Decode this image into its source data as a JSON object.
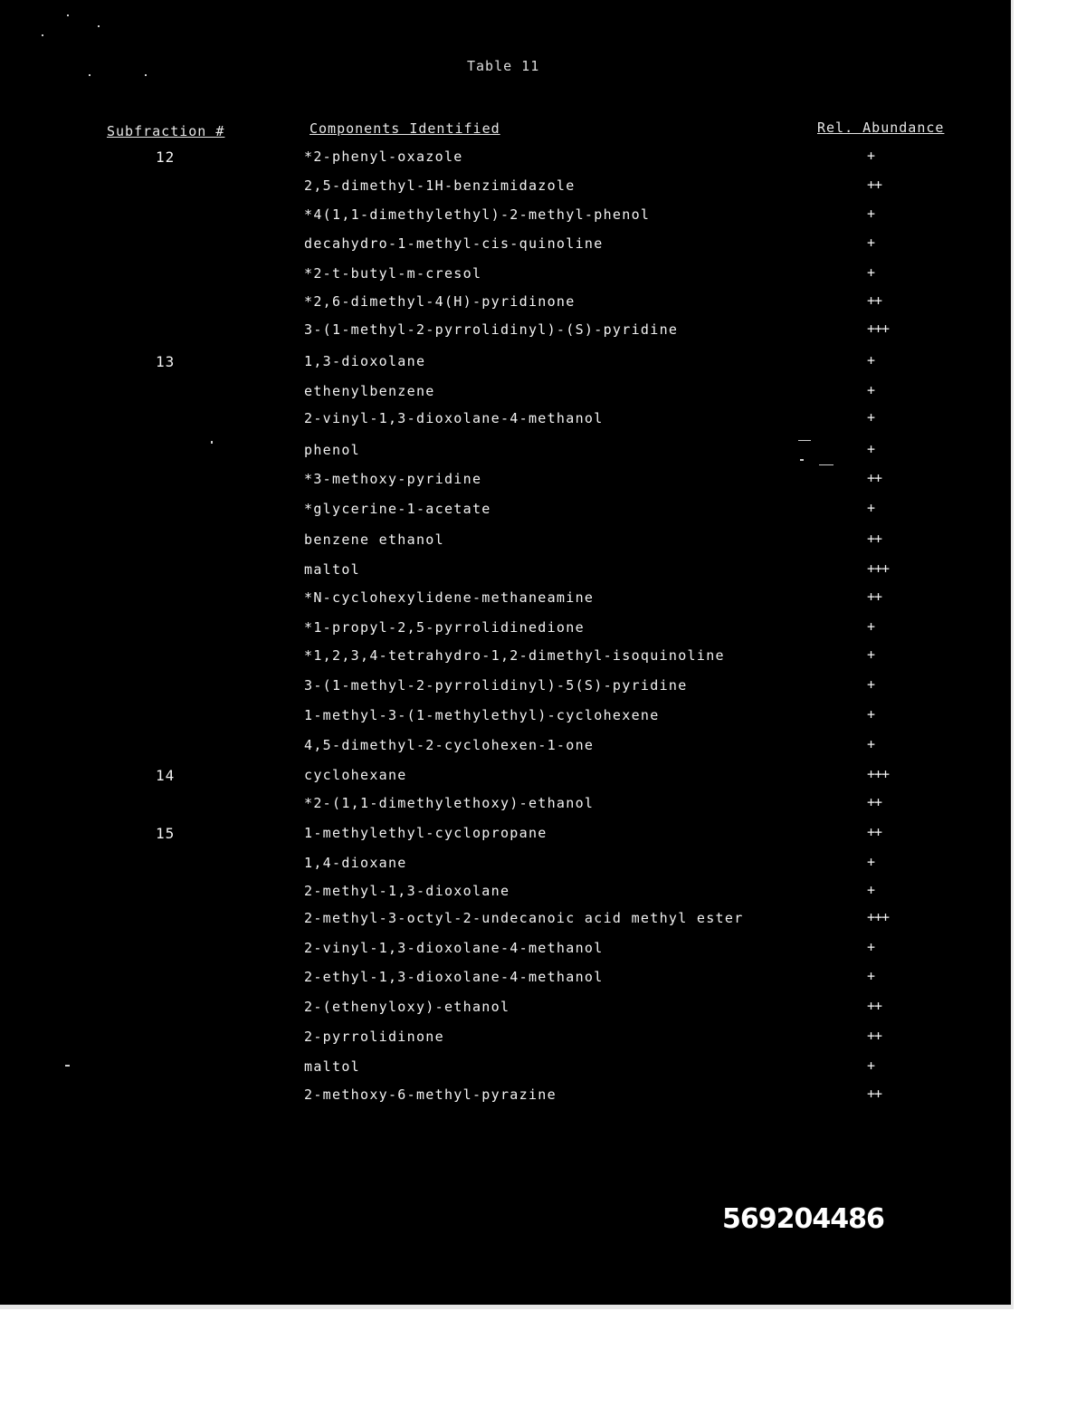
{
  "table": {
    "title": "Table 11",
    "headers": {
      "subfraction": "Subfraction #",
      "components": "Components Identified",
      "abundance": "Rel. Abundance"
    },
    "rows": [
      {
        "subfraction": "12",
        "component": "*2-phenyl-oxazole",
        "abundance": "+"
      },
      {
        "subfraction": "",
        "component": "2,5-dimethyl-1H-benzimidazole",
        "abundance": "++"
      },
      {
        "subfraction": "",
        "component": "*4(1,1-dimethylethyl)-2-methyl-phenol",
        "abundance": "+"
      },
      {
        "subfraction": "",
        "component": "decahydro-1-methyl-cis-quinoline",
        "abundance": "+"
      },
      {
        "subfraction": "",
        "component": "*2-t-butyl-m-cresol",
        "abundance": "+"
      },
      {
        "subfraction": "",
        "component": "*2,6-dimethyl-4(H)-pyridinone",
        "abundance": "++"
      },
      {
        "subfraction": "",
        "component": "3-(1-methyl-2-pyrrolidinyl)-(S)-pyridine",
        "abundance": "+++"
      },
      {
        "subfraction": "13",
        "component": "1,3-dioxolane",
        "abundance": "+"
      },
      {
        "subfraction": "",
        "component": "ethenylbenzene",
        "abundance": "+"
      },
      {
        "subfraction": "",
        "component": "2-vinyl-1,3-dioxolane-4-methanol",
        "abundance": "+"
      },
      {
        "subfraction": "",
        "component": "phenol",
        "abundance": "+"
      },
      {
        "subfraction": "",
        "component": "*3-methoxy-pyridine",
        "abundance": "++"
      },
      {
        "subfraction": "",
        "component": "*glycerine-1-acetate",
        "abundance": "+"
      },
      {
        "subfraction": "",
        "component": "benzene ethanol",
        "abundance": "++"
      },
      {
        "subfraction": "",
        "component": "maltol",
        "abundance": "+++"
      },
      {
        "subfraction": "",
        "component": "*N-cyclohexylidene-methaneamine",
        "abundance": "++"
      },
      {
        "subfraction": "",
        "component": "*1-propyl-2,5-pyrrolidinedione",
        "abundance": "+"
      },
      {
        "subfraction": "",
        "component": "*1,2,3,4-tetrahydro-1,2-dimethyl-isoquinoline",
        "abundance": "+"
      },
      {
        "subfraction": "",
        "component": "3-(1-methyl-2-pyrrolidinyl)-5(S)-pyridine",
        "abundance": "+"
      },
      {
        "subfraction": "",
        "component": "1-methyl-3-(1-methylethyl)-cyclohexene",
        "abundance": "+"
      },
      {
        "subfraction": "",
        "component": "4,5-dimethyl-2-cyclohexen-1-one",
        "abundance": "+"
      },
      {
        "subfraction": "14",
        "component": "cyclohexane",
        "abundance": "+++"
      },
      {
        "subfraction": "",
        "component": "*2-(1,1-dimethylethoxy)-ethanol",
        "abundance": "++"
      },
      {
        "subfraction": "15",
        "component": "1-methylethyl-cyclopropane",
        "abundance": "++"
      },
      {
        "subfraction": "",
        "component": "1,4-dioxane",
        "abundance": "+"
      },
      {
        "subfraction": "",
        "component": "2-methyl-1,3-dioxolane",
        "abundance": "+"
      },
      {
        "subfraction": "",
        "component": "2-methyl-3-octyl-2-undecanoic acid methyl ester",
        "abundance": "+++"
      },
      {
        "subfraction": "",
        "component": "2-vinyl-1,3-dioxolane-4-methanol",
        "abundance": "+"
      },
      {
        "subfraction": "",
        "component": "2-ethyl-1,3-dioxolane-4-methanol",
        "abundance": "+"
      },
      {
        "subfraction": "",
        "component": "2-(ethenyloxy)-ethanol",
        "abundance": "++"
      },
      {
        "subfraction": "",
        "component": "2-pyrrolidinone",
        "abundance": "++"
      },
      {
        "subfraction": "",
        "component": "maltol",
        "abundance": "+"
      },
      {
        "subfraction": "",
        "component": "2-methoxy-6-methyl-pyrazine",
        "abundance": "++"
      }
    ]
  },
  "document_number": "569204486"
}
